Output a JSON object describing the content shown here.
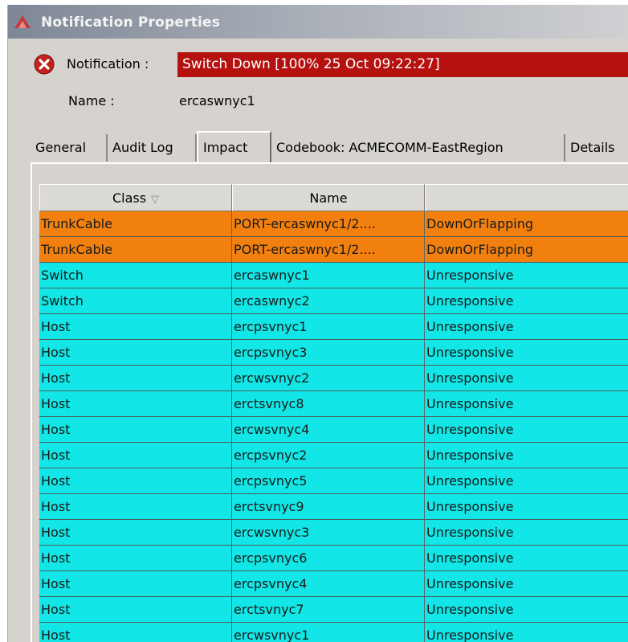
{
  "window": {
    "title": "Notification Properties",
    "titlebar_color": "#7e8796"
  },
  "notification": {
    "label": "Notification :",
    "value": "Switch Down  [100% 25 Oct 09:22:27]",
    "value_bg": "#b5110f",
    "icon": "error-icon"
  },
  "name_field": {
    "label": "Name :",
    "value": "ercaswnyc1"
  },
  "tabs": [
    {
      "label": "General",
      "active": false
    },
    {
      "label": "Audit Log",
      "active": false
    },
    {
      "label": "Impact",
      "active": true
    },
    {
      "label": "Codebook: ACMECOMM-EastRegion",
      "active": false
    },
    {
      "label": "Details",
      "active": false
    }
  ],
  "table": {
    "columns": [
      {
        "label": "Class",
        "sort_icon": "▽"
      },
      {
        "label": "Name"
      },
      {
        "label": ""
      }
    ],
    "row_colors": {
      "orange": "#f2800f",
      "cyan": "#12e6e6"
    },
    "rows": [
      {
        "severity": "orange",
        "class": "TrunkCable",
        "name": "PORT-ercaswnyc1/2....",
        "event": "DownOrFlapping"
      },
      {
        "severity": "orange",
        "class": "TrunkCable",
        "name": "PORT-ercaswnyc1/2....",
        "event": "DownOrFlapping"
      },
      {
        "severity": "cyan",
        "class": "Switch",
        "name": "ercaswnyc1",
        "event": "Unresponsive"
      },
      {
        "severity": "cyan",
        "class": "Switch",
        "name": "ercaswnyc2",
        "event": "Unresponsive"
      },
      {
        "severity": "cyan",
        "class": "Host",
        "name": "ercpsvnyc1",
        "event": "Unresponsive"
      },
      {
        "severity": "cyan",
        "class": "Host",
        "name": "ercpsvnyc3",
        "event": "Unresponsive"
      },
      {
        "severity": "cyan",
        "class": "Host",
        "name": "ercwsvnyc2",
        "event": "Unresponsive"
      },
      {
        "severity": "cyan",
        "class": "Host",
        "name": "erctsvnyc8",
        "event": "Unresponsive"
      },
      {
        "severity": "cyan",
        "class": "Host",
        "name": "ercwsvnyc4",
        "event": "Unresponsive"
      },
      {
        "severity": "cyan",
        "class": "Host",
        "name": "ercpsvnyc2",
        "event": "Unresponsive"
      },
      {
        "severity": "cyan",
        "class": "Host",
        "name": "ercpsvnyc5",
        "event": "Unresponsive"
      },
      {
        "severity": "cyan",
        "class": "Host",
        "name": "erctsvnyc9",
        "event": "Unresponsive"
      },
      {
        "severity": "cyan",
        "class": "Host",
        "name": "ercwsvnyc3",
        "event": "Unresponsive"
      },
      {
        "severity": "cyan",
        "class": "Host",
        "name": "ercpsvnyc6",
        "event": "Unresponsive"
      },
      {
        "severity": "cyan",
        "class": "Host",
        "name": "ercpsvnyc4",
        "event": "Unresponsive"
      },
      {
        "severity": "cyan",
        "class": "Host",
        "name": "erctsvnyc7",
        "event": "Unresponsive"
      },
      {
        "severity": "cyan",
        "class": "Host",
        "name": "ercwsvnyc1",
        "event": "Unresponsive"
      }
    ]
  }
}
